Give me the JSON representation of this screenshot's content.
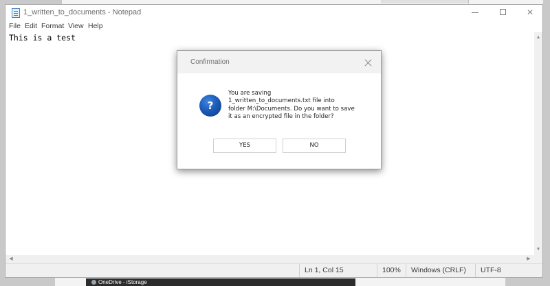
{
  "window": {
    "title": "1_written_to_documents - Notepad"
  },
  "window_controls": {
    "minimize_icon": "minimize-icon",
    "maximize_icon": "maximize-icon",
    "close_glyph": "✕"
  },
  "menu": {
    "items": [
      "File",
      "Edit",
      "Format",
      "View",
      "Help"
    ]
  },
  "editor": {
    "content": "This is a test"
  },
  "statusbar": {
    "position": "Ln 1, Col 15",
    "zoom": "100%",
    "line_ending": "Windows (CRLF)",
    "encoding": "UTF-8"
  },
  "dialog": {
    "title": "Confirmation",
    "icon_glyph": "?",
    "message_lines": [
      "You are saving",
      "1_written_to_documents.txt file into",
      "folder M:\\Documents. Do you want to save",
      "it as an encrypted file in the folder?"
    ],
    "yes_label": "YES",
    "no_label": "NO"
  },
  "scroll": {
    "up": "▲",
    "down": "▼",
    "left": "◀",
    "right": "▶"
  },
  "taskbar": {
    "item_label": "OneDrive - iStorage"
  },
  "colors": {
    "dialog_icon": "#1d5bb8",
    "window_background": "#ffffff",
    "desktop": "#c9c9c9"
  }
}
